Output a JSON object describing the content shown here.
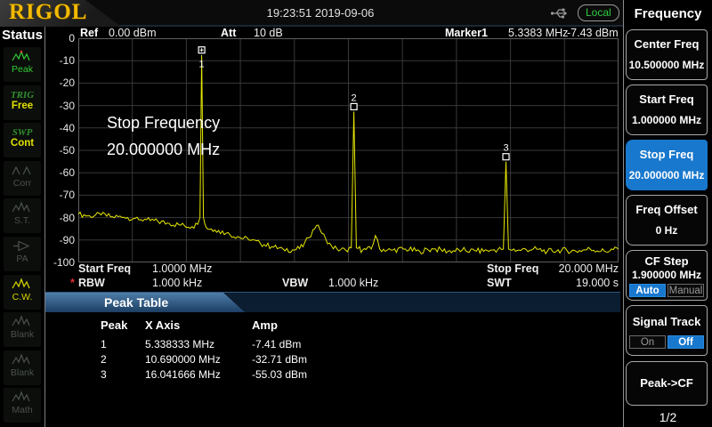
{
  "brand": {
    "logo": "RIGOL"
  },
  "top_bar": {
    "timestamp": "19:23:51 2019-09-06",
    "mode": "Local"
  },
  "sidebar": {
    "title": "Status",
    "items": [
      {
        "id": "peak",
        "label": "Peak",
        "style": "green",
        "icon": "peak-waveform-icon"
      },
      {
        "id": "trig",
        "top": "TRIG",
        "bottom": "Free"
      },
      {
        "id": "swp",
        "top": "SWP",
        "bottom": "Cont"
      },
      {
        "id": "corr",
        "label": "Corr",
        "style": "dim",
        "icon": "corr-waveform-icon"
      },
      {
        "id": "st",
        "label": "S.T.",
        "style": "dim",
        "icon": "st-waveform-icon"
      },
      {
        "id": "pa",
        "label": "PA",
        "style": "dim",
        "icon": "pa-amplifier-icon"
      },
      {
        "id": "cw",
        "label": "C.W.",
        "style": "yellow",
        "icon": "cw-waveform-icon"
      },
      {
        "id": "blank1",
        "label": "Blank",
        "style": "dim",
        "icon": "blank-waveform-icon"
      },
      {
        "id": "blank2",
        "label": "Blank",
        "style": "dim",
        "icon": "blank-waveform-icon"
      },
      {
        "id": "math",
        "label": "Math",
        "style": "dim",
        "icon": "math-waveform-icon"
      }
    ]
  },
  "readout": {
    "ref_label": "Ref",
    "ref_value": "0.00 dBm",
    "att_label": "Att",
    "att_value": "10 dB",
    "marker_label": "Marker1",
    "marker_freq": "5.3383 MHz",
    "marker_amp": "-7.43 dBm"
  },
  "overlay": {
    "line1": "Stop Frequency",
    "line2": "20.000000 MHz"
  },
  "footer": {
    "start_label": "Start Freq",
    "start_value": "1.0000 MHz",
    "stop_label": "Stop Freq",
    "stop_value": "20.000 MHz",
    "rbw_star": "*",
    "rbw_label": "RBW",
    "rbw_value": "1.000 kHz",
    "vbw_label": "VBW",
    "vbw_value": "1.000 kHz",
    "swt_label": "SWT",
    "swt_value": "19.000 s"
  },
  "peak_table": {
    "title": "Peak Table",
    "columns": [
      "Peak",
      "X Axis",
      "Amp"
    ],
    "rows": [
      [
        "1",
        "5.338333 MHz",
        "-7.41 dBm"
      ],
      [
        "2",
        "10.690000 MHz",
        "-32.71 dBm"
      ],
      [
        "3",
        "16.041666 MHz",
        "-55.03 dBm"
      ]
    ]
  },
  "menu": {
    "title": "Frequency",
    "page": "1/2",
    "buttons": [
      {
        "id": "center-freq",
        "label": "Center Freq",
        "value": "10.500000 MHz"
      },
      {
        "id": "start-freq",
        "label": "Start Freq",
        "value": "1.000000 MHz"
      },
      {
        "id": "stop-freq",
        "label": "Stop Freq",
        "value": "20.000000 MHz",
        "active": true
      },
      {
        "id": "freq-offset",
        "label": "Freq Offset",
        "value": "0 Hz"
      },
      {
        "id": "cf-step",
        "label": "CF Step",
        "value": "1.900000 MHz",
        "toggle": {
          "options": [
            "Auto",
            "Manual"
          ],
          "selected": "Auto"
        }
      },
      {
        "id": "signal-track",
        "label": "Signal Track",
        "toggle": {
          "options": [
            "On",
            "Off"
          ],
          "selected": "Off"
        }
      },
      {
        "id": "peak-to-cf",
        "label": "Peak->CF",
        "tall": true
      }
    ]
  },
  "colors": {
    "accent_blue": "#1878cd",
    "trace_yellow": "#e8e800",
    "brand_gold": "#f2ba00",
    "status_green": "#33cc33",
    "label_yellow": "#e0e000",
    "alert_red": "#e03030",
    "banner_blue": "#0b1d31"
  },
  "chart_data": {
    "type": "line",
    "title": "",
    "xlabel": "Frequency (MHz), Start 1.0000 MHz to Stop 20.000 MHz",
    "ylabel": "Amplitude (dBm), Ref 0.00 dBm",
    "x_range_mhz": [
      1.0,
      20.0
    ],
    "y_range_dbm": [
      -100,
      0
    ],
    "y_ticks": [
      0,
      -10,
      -20,
      -30,
      -40,
      -50,
      -60,
      -70,
      -80,
      -90,
      -100
    ],
    "grid_divisions": {
      "x": 10,
      "y": 10
    },
    "noise_db": 1.3,
    "anchors_mhz_dbm": [
      [
        1.0,
        -78.5
      ],
      [
        1.4,
        -79.2
      ],
      [
        1.8,
        -78.8
      ],
      [
        2.2,
        -79.6
      ],
      [
        2.6,
        -79.8
      ],
      [
        3.0,
        -80.3
      ],
      [
        3.4,
        -81.0
      ],
      [
        3.8,
        -81.8
      ],
      [
        4.2,
        -82.6
      ],
      [
        4.6,
        -83.4
      ],
      [
        5.0,
        -84.0
      ],
      [
        5.2,
        -83.0
      ],
      [
        5.28,
        -80.0
      ],
      [
        5.338333,
        -7.41
      ],
      [
        5.4,
        -80.0
      ],
      [
        5.5,
        -84.5
      ],
      [
        5.8,
        -85.5
      ],
      [
        6.2,
        -87.0
      ],
      [
        6.6,
        -88.5
      ],
      [
        7.0,
        -90.0
      ],
      [
        7.4,
        -91.5
      ],
      [
        7.8,
        -93.0
      ],
      [
        8.2,
        -94.0
      ],
      [
        8.6,
        -94.5
      ],
      [
        8.9,
        -93.0
      ],
      [
        9.1,
        -89.0
      ],
      [
        9.25,
        -85.5
      ],
      [
        9.38,
        -83.5
      ],
      [
        9.5,
        -85.5
      ],
      [
        9.7,
        -89.5
      ],
      [
        9.9,
        -92.5
      ],
      [
        10.1,
        -94.0
      ],
      [
        10.4,
        -94.5
      ],
      [
        10.6,
        -93.5
      ],
      [
        10.69,
        -32.71
      ],
      [
        10.78,
        -93.5
      ],
      [
        11.0,
        -94.5
      ],
      [
        11.3,
        -94.0
      ],
      [
        11.45,
        -88.0
      ],
      [
        11.6,
        -94.0
      ],
      [
        12.0,
        -94.5
      ],
      [
        12.5,
        -94.0
      ],
      [
        13.0,
        -95.0
      ],
      [
        13.5,
        -94.0
      ],
      [
        14.0,
        -95.0
      ],
      [
        14.5,
        -94.5
      ],
      [
        15.0,
        -95.0
      ],
      [
        15.5,
        -94.5
      ],
      [
        15.95,
        -94.0
      ],
      [
        16.041666,
        -55.03
      ],
      [
        16.13,
        -94.0
      ],
      [
        16.5,
        -94.5
      ],
      [
        17.0,
        -94.0
      ],
      [
        17.5,
        -95.0
      ],
      [
        18.0,
        -94.5
      ],
      [
        18.5,
        -95.0
      ],
      [
        19.0,
        -94.0
      ],
      [
        19.5,
        -95.0
      ],
      [
        20.0,
        -94.0
      ]
    ],
    "markers": [
      {
        "n": "1",
        "x_mhz": 5.338333,
        "y_dbm": -7.41,
        "label_pos": "below",
        "selected": true
      },
      {
        "n": "2",
        "x_mhz": 10.69,
        "y_dbm": -32.71,
        "label_pos": "above"
      },
      {
        "n": "3",
        "x_mhz": 16.041666,
        "y_dbm": -55.03,
        "label_pos": "above"
      }
    ]
  }
}
